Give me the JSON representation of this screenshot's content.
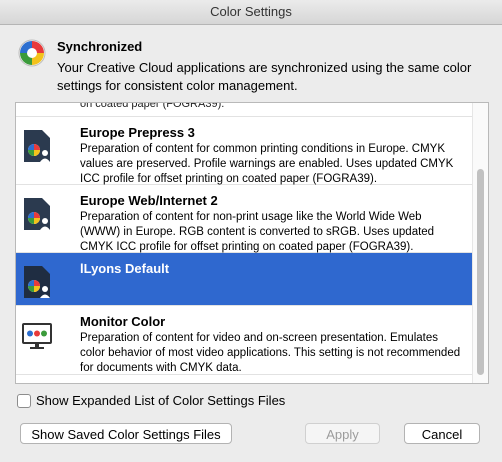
{
  "window": {
    "title": "Color Settings"
  },
  "header": {
    "icon": "color-wheel-icon",
    "status": "Synchronized",
    "description": "Your Creative Cloud applications are synchronized using the same color settings for consistent color management."
  },
  "list": {
    "partial_item_text": "on coated paper (FOGRA39).",
    "items": [
      {
        "title": "Europe Prepress 3",
        "description": "Preparation of content for common printing conditions in Europe. CMYK values are preserved. Profile warnings are enabled. Uses updated CMYK ICC profile for offset printing on coated paper (FOGRA39).",
        "icon": "color-settings-file-icon",
        "selected": false
      },
      {
        "title": "Europe Web/Internet 2",
        "description": "Preparation of content for non-print usage like the World Wide Web (WWW) in Europe. RGB content is converted to sRGB. Uses updated CMYK ICC profile for offset printing on coated paper (FOGRA39).",
        "icon": "color-settings-file-icon",
        "selected": false
      },
      {
        "title": "lLyons Default",
        "description": "",
        "icon": "color-settings-file-icon",
        "selected": true
      },
      {
        "title": "Monitor Color",
        "description": "Preparation of content for video and on-screen presentation. Emulates color behavior of most video applications. This setting is not recommended for documents with CMYK data.",
        "icon": "monitor-icon",
        "selected": false
      }
    ]
  },
  "options": {
    "expanded_list_label": "Show Expanded List of Color Settings Files",
    "expanded_list_checked": false
  },
  "buttons": {
    "show_saved": "Show Saved Color Settings Files",
    "apply": "Apply",
    "cancel": "Cancel"
  },
  "colors": {
    "selection": "#2f68cf"
  }
}
